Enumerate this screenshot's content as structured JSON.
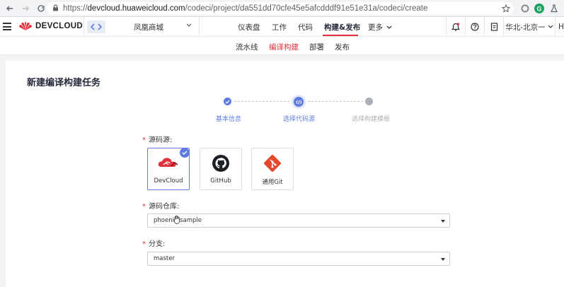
{
  "browser": {
    "url_prefix": "https://",
    "url_host": "devcloud.huaweicloud.com",
    "url_path": "/codeci/project/da551dd70cfe45e5afcdddf91e51e31a/codeci/create",
    "extension_g": "G"
  },
  "topnav": {
    "logo_text": "DEVCLOUD",
    "project_name": "凤凰商城",
    "items": [
      "仪表盘",
      "工作",
      "代码",
      "构建&发布",
      "更多"
    ],
    "region": "华北-北京一",
    "user_initial": "H"
  },
  "subnav": {
    "items": [
      "流水线",
      "编译构建",
      "部署",
      "发布"
    ]
  },
  "page": {
    "title": "新建编译构建任务"
  },
  "steps": [
    {
      "label": "基本信息",
      "state": "done"
    },
    {
      "label": "选择代码源",
      "state": "current"
    },
    {
      "label": "选择构建模板",
      "state": "pending"
    }
  ],
  "form": {
    "source_label": "源码源:",
    "sources": [
      {
        "label": "DevCloud",
        "icon": "devcloud-icon",
        "selected": true
      },
      {
        "label": "GitHub",
        "icon": "github-icon",
        "selected": false
      },
      {
        "label": "通用Git",
        "icon": "git-icon",
        "selected": false
      }
    ],
    "repo_label": "源码仓库:",
    "repo_value": "phoenix-sample",
    "branch_label": "分支:",
    "branch_value": "master"
  },
  "colors": {
    "brand_red": "#e0323c",
    "accent_blue": "#5e7ce0"
  }
}
